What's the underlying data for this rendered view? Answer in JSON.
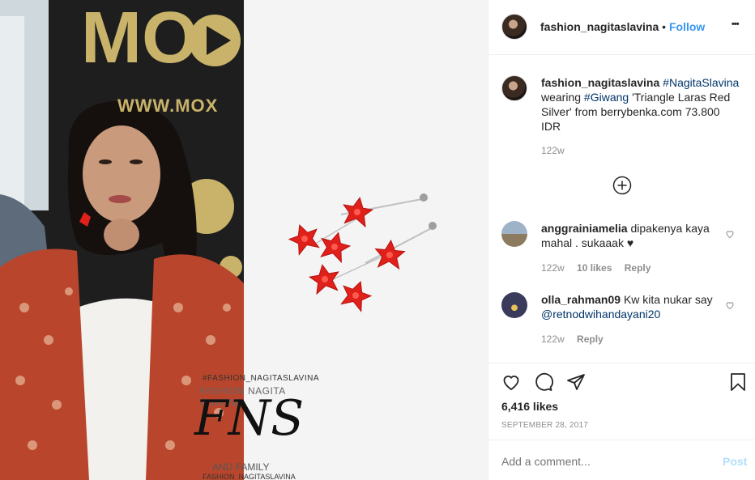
{
  "post": {
    "username": "fashion_nagitaslavina",
    "follow_label": "Follow",
    "separator": "•",
    "more_label": "•••"
  },
  "caption": {
    "username": "fashion_nagitaslavina",
    "hashtag1": "#NagitaSlavina",
    "text1": "wearing",
    "hashtag2": "#Giwang",
    "text2": "'Triangle Laras Red Silver' from berrybenka.com 73.800 IDR",
    "time": "122w"
  },
  "comments": [
    {
      "username": "anggrainiamelia",
      "text": "dipakenya kaya mahal . sukaaak ♥",
      "time": "122w",
      "likes": "10 likes",
      "reply": "Reply"
    },
    {
      "username": "olla_rahman09",
      "text": "Kw kita nukar say",
      "mention": "@retnodwihandayani20",
      "time": "122w",
      "reply": "Reply"
    }
  ],
  "actions": {
    "likes": "6,416 likes",
    "date": "SEPTEMBER 28, 2017"
  },
  "composer": {
    "placeholder": "Add a comment...",
    "post_label": "Post"
  },
  "image": {
    "banner_text": "MO",
    "url_text": "WWW.MOX",
    "watermark_top": "#FASHION_NAGITASLAVINA",
    "watermark_sub": "FASHION NAGITA SLAVINA",
    "watermark_logo": "FNS",
    "watermark_family": "AND FAMILY",
    "watermark_bottom": "FASHION_NAGITASLAVINA"
  },
  "colors": {
    "accent": "#3897f0",
    "link": "#003569",
    "earring_red": "#e0201a"
  }
}
